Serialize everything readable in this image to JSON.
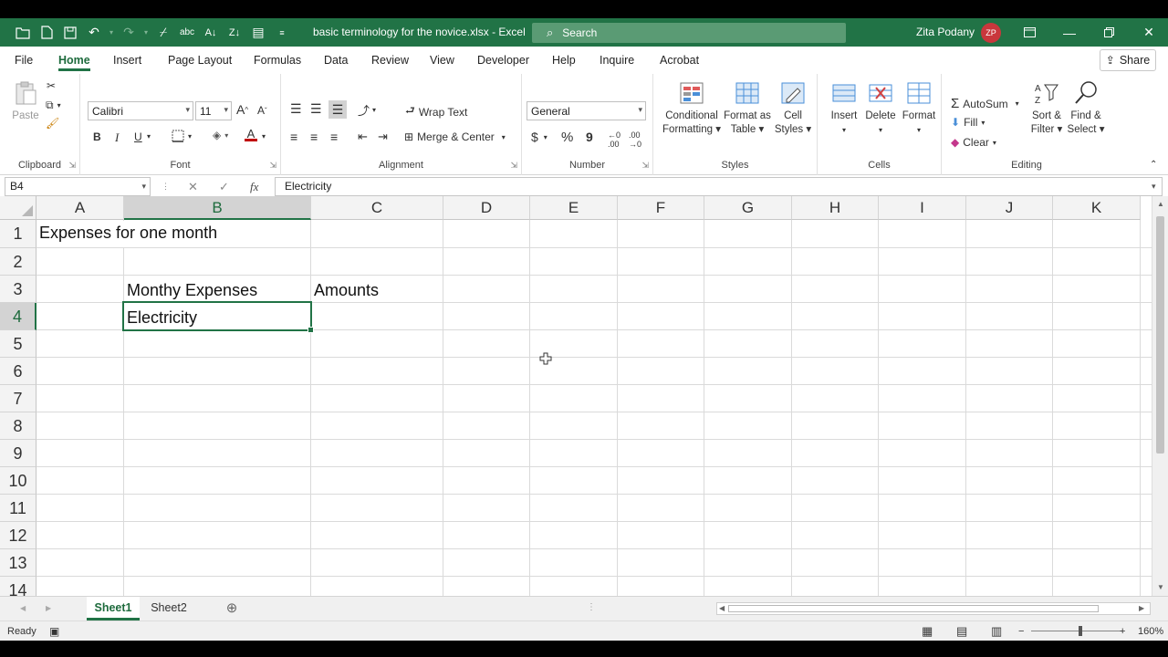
{
  "window": {
    "doc_title": "basic terminology for the novice.xlsx  -  Excel",
    "search_placeholder": "Search",
    "user_name": "Zita Podany",
    "user_initials": "ZP"
  },
  "menu": {
    "tabs": [
      "File",
      "Home",
      "Insert",
      "Page Layout",
      "Formulas",
      "Data",
      "Review",
      "View",
      "Developer",
      "Help",
      "Inquire",
      "Acrobat"
    ],
    "active_tab": "Home",
    "share_label": "Share"
  },
  "ribbon": {
    "clipboard": {
      "paste_label": "Paste",
      "group_label": "Clipboard"
    },
    "font": {
      "font_name": "Calibri",
      "font_size": "11",
      "group_label": "Font",
      "bold": "B",
      "italic": "I",
      "underline": "U"
    },
    "alignment": {
      "wrap_text": "Wrap Text",
      "merge_center": "Merge & Center",
      "group_label": "Alignment"
    },
    "number": {
      "format": "General",
      "currency": "$",
      "percent": "%",
      "comma": "9",
      "group_label": "Number"
    },
    "styles": {
      "conditional_formatting": [
        "Conditional",
        "Formatting"
      ],
      "format_as_table": [
        "Format as",
        "Table"
      ],
      "cell_styles": [
        "Cell",
        "Styles"
      ],
      "group_label": "Styles"
    },
    "cells": {
      "insert": "Insert",
      "delete": "Delete",
      "format": "Format",
      "group_label": "Cells"
    },
    "editing": {
      "autosum": "AutoSum",
      "fill": "Fill",
      "clear": "Clear",
      "sort_filter": [
        "Sort &",
        "Filter"
      ],
      "find_select": [
        "Find &",
        "Select"
      ],
      "group_label": "Editing"
    }
  },
  "formula_bar": {
    "name_box": "B4",
    "content": "Electricity"
  },
  "grid": {
    "columns": [
      "A",
      "B",
      "C",
      "D",
      "E",
      "F",
      "G",
      "H",
      "I",
      "J",
      "K"
    ],
    "rows": [
      "1",
      "2",
      "3",
      "4",
      "5",
      "6",
      "7",
      "8",
      "9",
      "10",
      "11",
      "12",
      "13",
      "14"
    ],
    "selected_cell": "B4",
    "cells": {
      "A1": "Expenses for one month",
      "B3": "Monthy Expenses",
      "C3": "Amounts",
      "B4": "Electricity"
    }
  },
  "sheets": {
    "tabs": [
      "Sheet1",
      "Sheet2"
    ],
    "active": "Sheet1"
  },
  "status": {
    "mode": "Ready",
    "zoom": "160%"
  },
  "colors": {
    "brand": "#217346",
    "selection": "#217346"
  }
}
